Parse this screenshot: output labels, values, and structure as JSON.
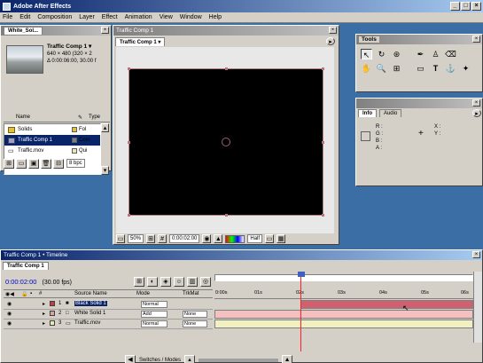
{
  "app": {
    "title": "Adobe After Effects"
  },
  "menu": [
    "File",
    "Edit",
    "Composition",
    "Layer",
    "Effect",
    "Animation",
    "View",
    "Window",
    "Help"
  ],
  "project": {
    "tab": "White_Sol...",
    "selected_name": "Traffic Comp 1 ▾",
    "selected_dims": "640 × 480 (320 × 2",
    "selected_duration": "Δ 0:00:06:00, 30.00 f",
    "col_name": "Name",
    "col_type": "Type",
    "items": [
      {
        "name": "Solids",
        "type": "Fol",
        "color": "#e0c040"
      },
      {
        "name": "Traffic Comp 1",
        "type": "Com",
        "color": "#808080"
      },
      {
        "name": "Traffic.mov",
        "type": "Qui",
        "color": "#e8e8b0"
      }
    ],
    "bpc": "8 bpc"
  },
  "comp": {
    "title": "Traffic Comp 1",
    "tab": "Traffic Comp 1 ▾",
    "zoom": "50%",
    "time": "0:00:02:00",
    "resolution": "Half"
  },
  "tools": {
    "title": "Tools"
  },
  "info": {
    "tab1": "Info",
    "tab2": "Audio",
    "r": "R :",
    "g": "G :",
    "b": "B :",
    "a": "A :",
    "x": "X :",
    "y": "Y :"
  },
  "timeline": {
    "title": "Traffic Comp 1 • Timeline",
    "tab": "Traffic Comp 1",
    "time": "0:00:02:00",
    "fps": "(30.00 fps)",
    "col_source": "Source Name",
    "col_mode": "Mode",
    "col_trkmat": "TrkMat",
    "layers": [
      {
        "num": "1",
        "name": "Black Solid 1",
        "mode": "Normal",
        "trkmat": "",
        "color": "#c04040"
      },
      {
        "num": "2",
        "name": "White Solid 1",
        "mode": "Add",
        "trkmat": "None",
        "color": "#e0a0a0"
      },
      {
        "num": "3",
        "name": "Traffic.mov",
        "mode": "Normal",
        "trkmat": "None",
        "color": "#e8e8b0"
      }
    ],
    "ruler": [
      "0:00s",
      "01s",
      "02s",
      "03s",
      "04s",
      "05s",
      "06s"
    ],
    "switches": "Switches / Modes"
  },
  "colors": {
    "titlebar": "#0a246a",
    "panel": "#d4d0c8",
    "selection": "#0a246a",
    "cti": "#ff2020"
  }
}
